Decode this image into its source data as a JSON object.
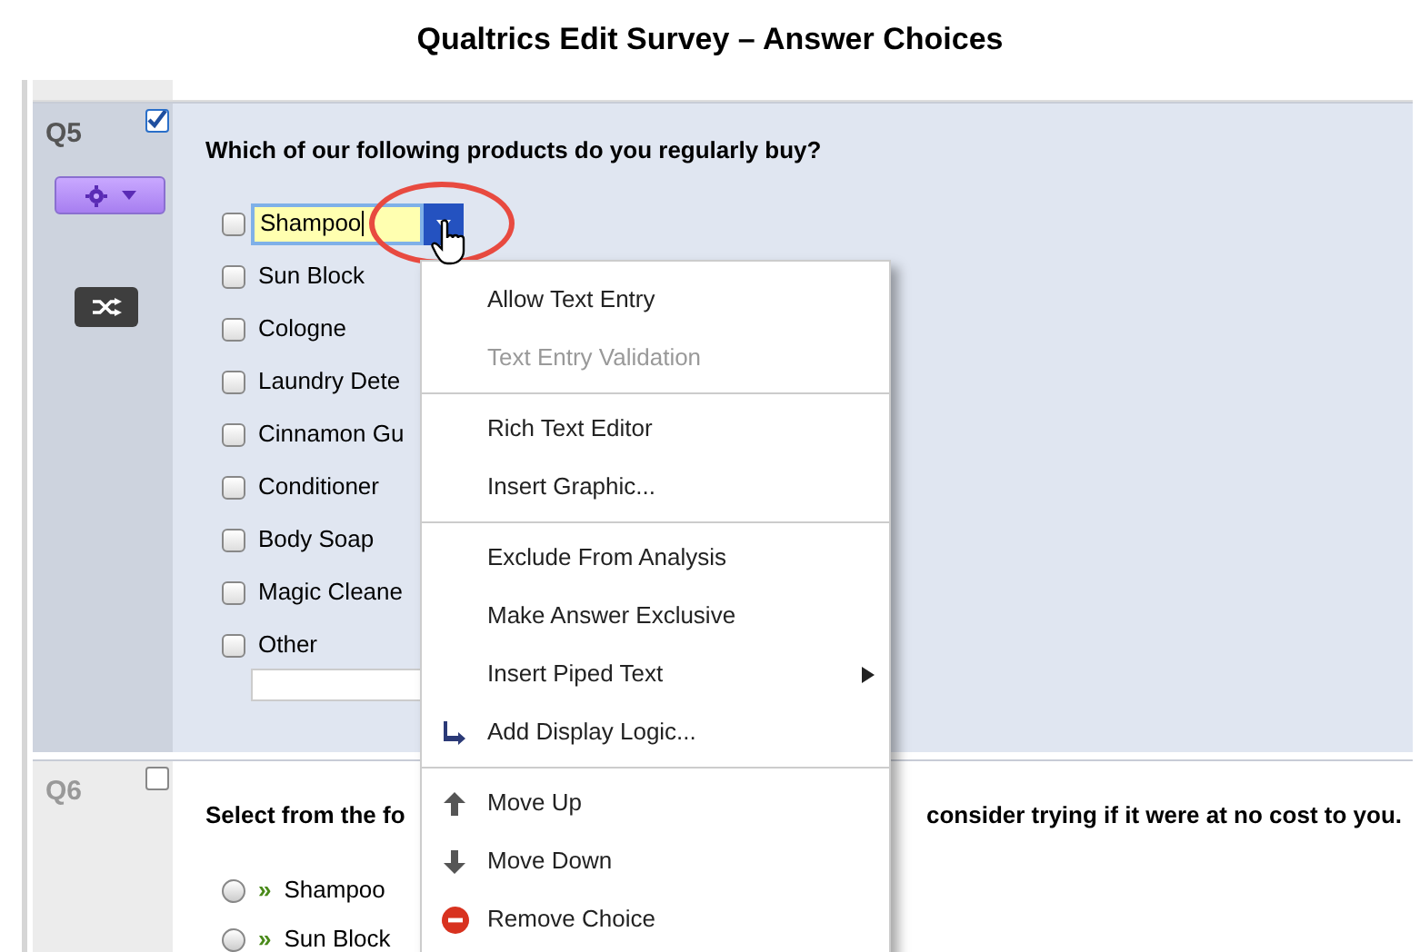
{
  "title": "Qualtrics Edit Survey – Answer Choices",
  "questions": [
    {
      "number": "Q5",
      "selected": true,
      "kind": "checkbox",
      "text_parts": [
        "Which of our following products do you regularly buy?"
      ],
      "choices": [
        {
          "label": "Shampoo",
          "editing": true,
          "text_entry": false
        },
        {
          "label": "Sun Block",
          "editing": false,
          "text_entry": false
        },
        {
          "label": "Cologne",
          "editing": false,
          "text_entry": false
        },
        {
          "label": "Laundry Dete",
          "editing": false,
          "text_entry": false
        },
        {
          "label": "Cinnamon Gu",
          "editing": false,
          "text_entry": false
        },
        {
          "label": "Conditioner",
          "editing": false,
          "text_entry": false
        },
        {
          "label": "Body Soap",
          "editing": false,
          "text_entry": false
        },
        {
          "label": "Magic Cleane",
          "editing": false,
          "text_entry": false
        },
        {
          "label": "Other",
          "editing": false,
          "text_entry": true
        }
      ]
    },
    {
      "number": "Q6",
      "selected": false,
      "kind": "radio",
      "marker": "»",
      "text_parts": [
        "Select from the fo",
        "consider trying if it were at no cost to you."
      ],
      "choices": [
        {
          "label": "Shampoo",
          "editing": false,
          "text_entry": false
        },
        {
          "label": "Sun Block",
          "editing": false,
          "text_entry": false
        }
      ]
    }
  ],
  "menu": {
    "sections": [
      [
        {
          "label": "Allow Text Entry",
          "disabled": false,
          "kind": "plain",
          "submenu": false
        },
        {
          "label": "Text Entry Validation",
          "disabled": true,
          "kind": "plain",
          "submenu": false
        }
      ],
      [
        {
          "label": "Rich Text Editor",
          "disabled": false,
          "kind": "plain",
          "submenu": false
        },
        {
          "label": "Insert Graphic...",
          "disabled": false,
          "kind": "plain",
          "submenu": false
        }
      ],
      [
        {
          "label": "Exclude From Analysis",
          "disabled": false,
          "kind": "plain",
          "submenu": false
        },
        {
          "label": "Make Answer Exclusive",
          "disabled": false,
          "kind": "plain",
          "submenu": false
        },
        {
          "label": "Insert Piped Text",
          "disabled": false,
          "kind": "plain",
          "submenu": true
        },
        {
          "label": "Add Display Logic...",
          "disabled": false,
          "kind": "logic",
          "submenu": false
        }
      ],
      [
        {
          "label": "Move Up",
          "disabled": false,
          "kind": "up",
          "submenu": false
        },
        {
          "label": "Move Down",
          "disabled": false,
          "kind": "down",
          "submenu": false
        },
        {
          "label": "Remove Choice",
          "disabled": false,
          "kind": "remove",
          "submenu": false
        }
      ]
    ]
  }
}
